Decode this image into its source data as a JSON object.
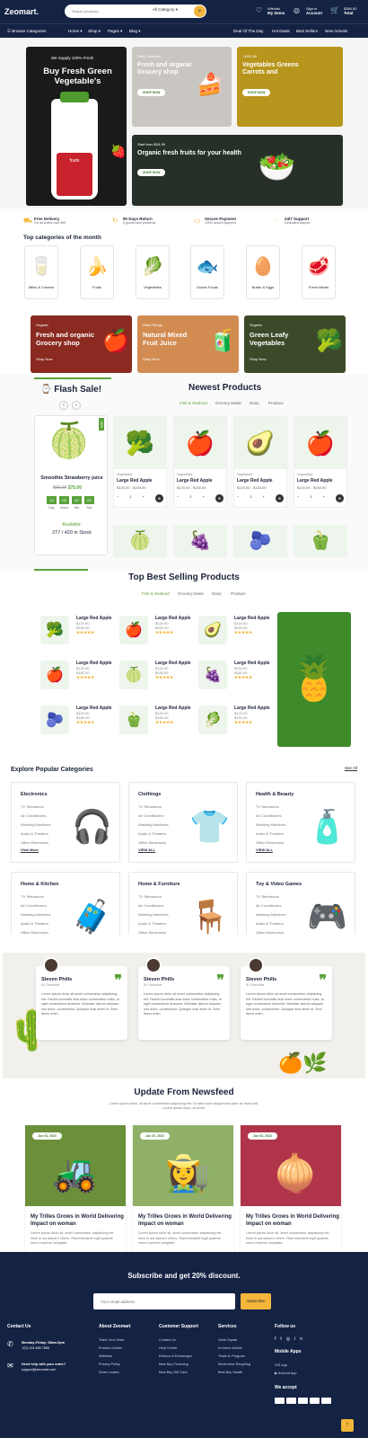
{
  "header": {
    "logo": "Zeomart.",
    "search_placeholder": "Search products...",
    "category_select": "All Category",
    "wishlist_top": "Wishlist",
    "wishlist_bottom": "My Items",
    "signin_top": "Sign in",
    "signin_bottom": "Account",
    "cart_top": "$350.00",
    "cart_bottom": "Total",
    "cart_count": "0"
  },
  "nav": {
    "browse": "Browse Categories",
    "links": [
      "Home",
      "Shop",
      "Pages",
      "Blog"
    ],
    "right_links": [
      "Deal Of The Day",
      "Hot Deals",
      "Best Sellers",
      "New Arrivals"
    ]
  },
  "hero": {
    "main": {
      "kicker": "We Supply 100% Fresh",
      "title": "Buy Fresh Green Vegetable's",
      "bottle_label": "fruits"
    },
    "b1": {
      "kicker": "Daily Essential",
      "title": "Fresh and organic Grocery shop",
      "btn": "SHOP NOW"
    },
    "b2": {
      "kicker": "-30% Off",
      "title": "Vegetables Greens Carrots and",
      "btn": "SHOP NOW"
    },
    "b3": {
      "kicker": "Start from $04.99",
      "title": "Organic fresh fruits for your health",
      "btn": "SHOP NOW"
    }
  },
  "features": [
    {
      "title": "Free Delivery",
      "sub": "For all orders over $99"
    },
    {
      "title": "90 Days Return",
      "sub": "If goods have problems"
    },
    {
      "title": "Secure Payment",
      "sub": "100% secure payment"
    },
    {
      "title": "24/7 Support",
      "sub": "Dedicated support"
    }
  ],
  "top_categories": {
    "title": "Top categories of the month",
    "items": [
      "Milks & Creams",
      "Fruits",
      "Vegetables",
      "Ocean Foods",
      "Butter & Eggs",
      "Fresh Meats"
    ]
  },
  "promo": [
    {
      "kicker": "Organic",
      "title": "Fresh and organic Grocery shop",
      "link": "Shop Now"
    },
    {
      "kicker": "Wine Range",
      "title": "Natural Mixed Fruit Juice",
      "link": "Shop Now"
    },
    {
      "kicker": "Organic",
      "title": "Green Leafy Vegetables",
      "link": "Shop Now"
    }
  ],
  "flash": {
    "title": "Flash Sale!",
    "product": "Smoothie Strawberry juice",
    "old_price": "$96.00",
    "price": "$75.00",
    "countdown": [
      "13",
      "08",
      "40",
      "00"
    ],
    "countdown_labels": [
      "Day",
      "Hours",
      "Min",
      "Sec"
    ],
    "available_label": "Available:",
    "stock": "277 / 420 in Stock",
    "discount": "-30%"
  },
  "newest": {
    "title": "Newest Products",
    "tabs": [
      "Fish & Seafood",
      "Grocery Deals",
      "Dairy",
      "Produce"
    ],
    "products": [
      {
        "cat": "Vegetables",
        "name": "Large Red Apple",
        "price": "$120.00 - $160.00"
      },
      {
        "cat": "Vegetables",
        "name": "Large Red Apple",
        "price": "$120.00 - $160.00"
      },
      {
        "cat": "Vegetables",
        "name": "Large Red Apple",
        "price": "$120.00 - $160.00"
      },
      {
        "cat": "Vegetables",
        "name": "Large Red Apple",
        "price": "$120.00 - $160.00"
      }
    ],
    "qty": "1"
  },
  "best": {
    "title": "Top Best Selling Products",
    "tabs": [
      "Fish & Seafood",
      "Grocery Deals",
      "Dairy",
      "Produce"
    ],
    "item_name": "Large Red Apple",
    "price1": "$120.00",
    "price2": "$160.00"
  },
  "explore": {
    "title": "Explore Popular Categories",
    "see_all": "See All",
    "boxes": [
      {
        "title": "Electronics",
        "items": [
          "TV Televisions",
          "Air Conditioners",
          "Washing Machines",
          "Audio & Theaters",
          "Office Electronics"
        ],
        "more": "View More"
      },
      {
        "title": "Clothings",
        "items": [
          "TV Televisions",
          "Air Conditioners",
          "Washing Machines",
          "Audio & Theaters",
          "Office Electronics"
        ],
        "more": "VIEW ALL"
      },
      {
        "title": "Health & Beauty",
        "items": [
          "TV Televisions",
          "Air Conditioners",
          "Washing Machines",
          "Audio & Theaters",
          "Office Electronics"
        ],
        "more": "VIEW ALL"
      },
      {
        "title": "Home & Kitchen",
        "items": [
          "TV Televisions",
          "Air Conditioners",
          "Washing Machines",
          "Audio & Theaters",
          "Office Electronics"
        ]
      },
      {
        "title": "Home & Furniture",
        "items": [
          "TV Televisions",
          "Air Conditioners",
          "Washing Machines",
          "Audio & Theaters",
          "Office Electronics"
        ]
      },
      {
        "title": "Toy & Video Games",
        "items": [
          "TV Televisions",
          "Air Conditioners",
          "Washing Machines",
          "Audio & Theaters",
          "Office Electronics"
        ]
      }
    ]
  },
  "testimonials": {
    "name": "Steven Phills",
    "role": "Sr. Executive",
    "text": "Lorem ipsum dolor sit amet consectetur adipiscing elit. Facilisi convallis duis dolor consectetur nulla, ut eget consectetur dictumst. Molestie dictum aliquam sed dolor, consectetur. Quisque duis amet ut. Sem libero enim."
  },
  "newsfeed": {
    "title": "Update From Newsfeed",
    "subtitle": "Lorem ipsum dolor, sit amet consectetur adipiscing elit. Ut ante dolor aliquet sed dolor ac libero elit. Lorem ipsum dolor, sit amet.",
    "posts": [
      {
        "date": "Jun 03, 2023",
        "title": "My Trilles Grows in World Delivering Impact on woman",
        "text": "Lorem ipsum dolor sit, amet consectetur adipisicing elit. Illum in aut assum! Libero. Reprehenderit fugit quaerat nemo maxime voluptate."
      },
      {
        "date": "Jun 03, 2023",
        "title": "My Trilles Grows in World Delivering Impact on woman",
        "text": "Lorem ipsum dolor sit, amet consectetur adipisicing elit. Illum in aut assum! Libero. Reprehenderit fugit quaerat nemo maxime voluptate."
      },
      {
        "date": "Jun 03, 2023",
        "title": "My Trilles Grows in World Delivering Impact on woman",
        "text": "Lorem ipsum dolor sit, amet consectetur adipisicing elit. Illum in aut assum! Libero. Reprehenderit fugit quaerat nemo maxime voluptate."
      }
    ]
  },
  "footer": {
    "subscribe_title": "Subscribe and get 20% discount.",
    "email_placeholder": "Your email address",
    "subscribe_btn": "Subscribe",
    "contact": {
      "title": "Contact Us",
      "hours": "Monday-Friday: 08am-9pm",
      "phone": "+(0) 123 456 7890",
      "help": "Need help with your order?",
      "email": "support@zeomart.com"
    },
    "cols": [
      {
        "title": "About Zeomart",
        "links": [
          "Track Your Order",
          "Product Guides",
          "Wishlists",
          "Privacy Policy",
          "Store Locator"
        ]
      },
      {
        "title": "Customer Support",
        "links": [
          "Contact Us",
          "Help Centre",
          "Returns & Exchanges",
          "Best Buy Financing",
          "Best Buy Gift Card"
        ]
      },
      {
        "title": "Services",
        "links": [
          "Geek Squad",
          "In-Home Advice",
          "Trade-In Program",
          "Electronics Recycling",
          "Best Buy Health"
        ]
      }
    ],
    "follow": "Follow us",
    "apps": "Mobile Apps",
    "ios": "iOS App",
    "android": "Android App",
    "accept": "We accept"
  }
}
